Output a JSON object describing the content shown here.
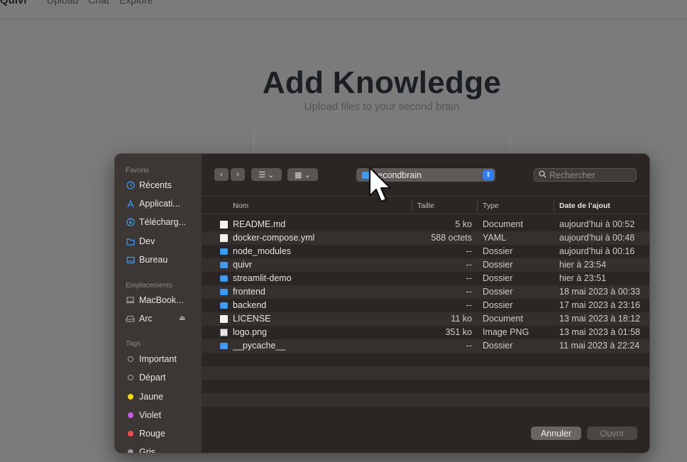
{
  "app": {
    "logo": "Quivr",
    "nav": [
      "Upload",
      "Chat",
      "Explore"
    ],
    "title": "Add Knowledge",
    "subtitle": "Upload files to your second brain"
  },
  "dialog": {
    "sidebar": {
      "favorites_label": "Favoris",
      "favorites": [
        {
          "label": "Récents",
          "icon": "clock-icon"
        },
        {
          "label": "Applicati...",
          "icon": "applications-icon"
        },
        {
          "label": "Télécharg...",
          "icon": "download-icon"
        },
        {
          "label": "Dev",
          "icon": "folder-icon"
        },
        {
          "label": "Bureau",
          "icon": "desktop-icon"
        }
      ],
      "locations_label": "Emplacements",
      "locations": [
        {
          "label": "MacBook...",
          "icon": "laptop-icon"
        },
        {
          "label": "Arc",
          "icon": "drive-icon",
          "eject": "⏏"
        }
      ],
      "tags_label": "Tags",
      "tags": [
        {
          "label": "Important",
          "color": "none"
        },
        {
          "label": "Départ",
          "color": "none"
        },
        {
          "label": "Jaune",
          "color": "#f5d90a"
        },
        {
          "label": "Violet",
          "color": "#c65de0"
        },
        {
          "label": "Rouge",
          "color": "#f04d4d"
        },
        {
          "label": "Gris",
          "color": "#9a9a9a"
        }
      ]
    },
    "toolbar": {
      "back": "‹",
      "forward": "›",
      "list_view": "☰ ⌄",
      "grid_view": "▦ ⌄",
      "current_folder": "secondbrain",
      "search_placeholder": "Rechercher"
    },
    "columns": {
      "name": "Nom",
      "size": "Taille",
      "type": "Type",
      "date": "Date de l’ajout"
    },
    "files": [
      {
        "name": "README.md",
        "size": "5 ko",
        "type": "Document",
        "date": "aujourd’hui à 00:52",
        "kind": "doc"
      },
      {
        "name": "docker-compose.yml",
        "size": "588 octets",
        "type": "YAML",
        "date": "aujourd’hui à 00:48",
        "kind": "yml"
      },
      {
        "name": "node_modules",
        "size": "--",
        "type": "Dossier",
        "date": "aujourd’hui à 00:16",
        "kind": "folder"
      },
      {
        "name": "quivr",
        "size": "--",
        "type": "Dossier",
        "date": "hier à 23:54",
        "kind": "folder"
      },
      {
        "name": "streamlit-demo",
        "size": "--",
        "type": "Dossier",
        "date": "hier à 23:51",
        "kind": "folder"
      },
      {
        "name": "frontend",
        "size": "--",
        "type": "Dossier",
        "date": "18 mai 2023 à 00:33",
        "kind": "folder"
      },
      {
        "name": "backend",
        "size": "--",
        "type": "Dossier",
        "date": "17 mai 2023 à 23:16",
        "kind": "folder"
      },
      {
        "name": "LICENSE",
        "size": "11 ko",
        "type": "Document",
        "date": "13 mai 2023 à 18:12",
        "kind": "doc"
      },
      {
        "name": "logo.png",
        "size": "351 ko",
        "type": "Image PNG",
        "date": "13 mai 2023 à 01:58",
        "kind": "img"
      },
      {
        "name": "__pycache__",
        "size": "--",
        "type": "Dossier",
        "date": "11 mai 2023 à 22:24",
        "kind": "folder"
      }
    ],
    "buttons": {
      "cancel": "Annuler",
      "open": "Ouvrir"
    }
  }
}
